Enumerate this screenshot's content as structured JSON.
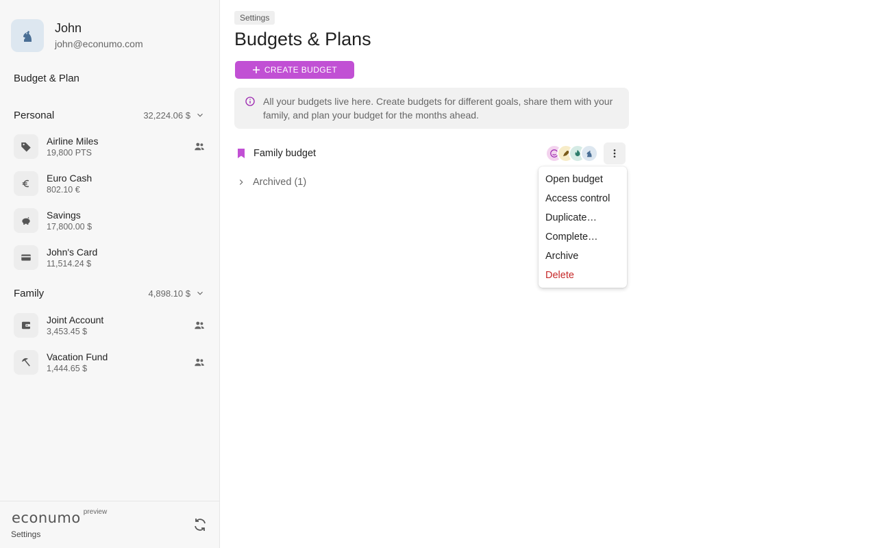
{
  "user": {
    "name": "John",
    "email": "john@econumo.com"
  },
  "sidebar": {
    "nav_label": "Budget & Plan",
    "groups": [
      {
        "name": "Personal",
        "total": "32,224.06 $",
        "accounts": [
          {
            "name": "Airline Miles",
            "balance": "19,800 PTS",
            "icon": "tag-icon",
            "shared": true
          },
          {
            "name": "Euro Cash",
            "balance": "802.10 €",
            "icon": "euro-icon",
            "shared": false
          },
          {
            "name": "Savings",
            "balance": "17,800.00 $",
            "icon": "piggy-bank-icon",
            "shared": false
          },
          {
            "name": "John's Card",
            "balance": "11,514.24 $",
            "icon": "credit-card-icon",
            "shared": false
          }
        ]
      },
      {
        "name": "Family",
        "total": "4,898.10 $",
        "accounts": [
          {
            "name": "Joint Account",
            "balance": "3,453.45 $",
            "icon": "wallet-icon",
            "shared": true
          },
          {
            "name": "Vacation Fund",
            "balance": "1,444.65 $",
            "icon": "beach-umbrella-icon",
            "shared": true
          }
        ]
      }
    ],
    "footer": {
      "logo_text": "econumo",
      "logo_badge": "preview",
      "settings_label": "Settings"
    }
  },
  "main": {
    "breadcrumb": "Settings",
    "title": "Budgets & Plans",
    "create_button": "CREATE BUDGET",
    "info_text": "All your budgets live here. Create budgets for different goals, share them with your family, and plan your budget for the months ahead.",
    "budgets": [
      {
        "name": "Family budget"
      }
    ],
    "archived_label": "Archived (1)",
    "menu": {
      "items": [
        "Open budget",
        "Access control",
        "Duplicate…",
        "Complete…",
        "Archive",
        "Delete"
      ]
    }
  },
  "colors": {
    "accent": "#c150d4",
    "danger": "#c62828",
    "avatar_blue": "#4a6f95"
  }
}
